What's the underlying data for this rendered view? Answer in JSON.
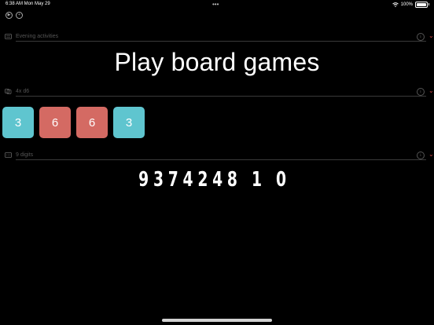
{
  "status_bar": {
    "time_date": "6:38 AM  Mon May 29",
    "battery": "100%"
  },
  "icons": {
    "top": [
      "play-circle-icon",
      "plus-circle-icon"
    ],
    "wifi": "wifi-icon"
  },
  "activities": {
    "placeholder": "Evening activities",
    "result": "Play board games"
  },
  "dice": {
    "placeholder": "4x d6",
    "values": [
      "3",
      "6",
      "6",
      "3"
    ],
    "colors": [
      "#5fc5cf",
      "#d46a63",
      "#d46a63",
      "#5fc5cf"
    ]
  },
  "digits": {
    "placeholder": "9 digits",
    "result": "9374248 1 0"
  },
  "colors": {
    "accent": "#d04848",
    "teal": "#5fc5cf",
    "red": "#d46a63"
  }
}
